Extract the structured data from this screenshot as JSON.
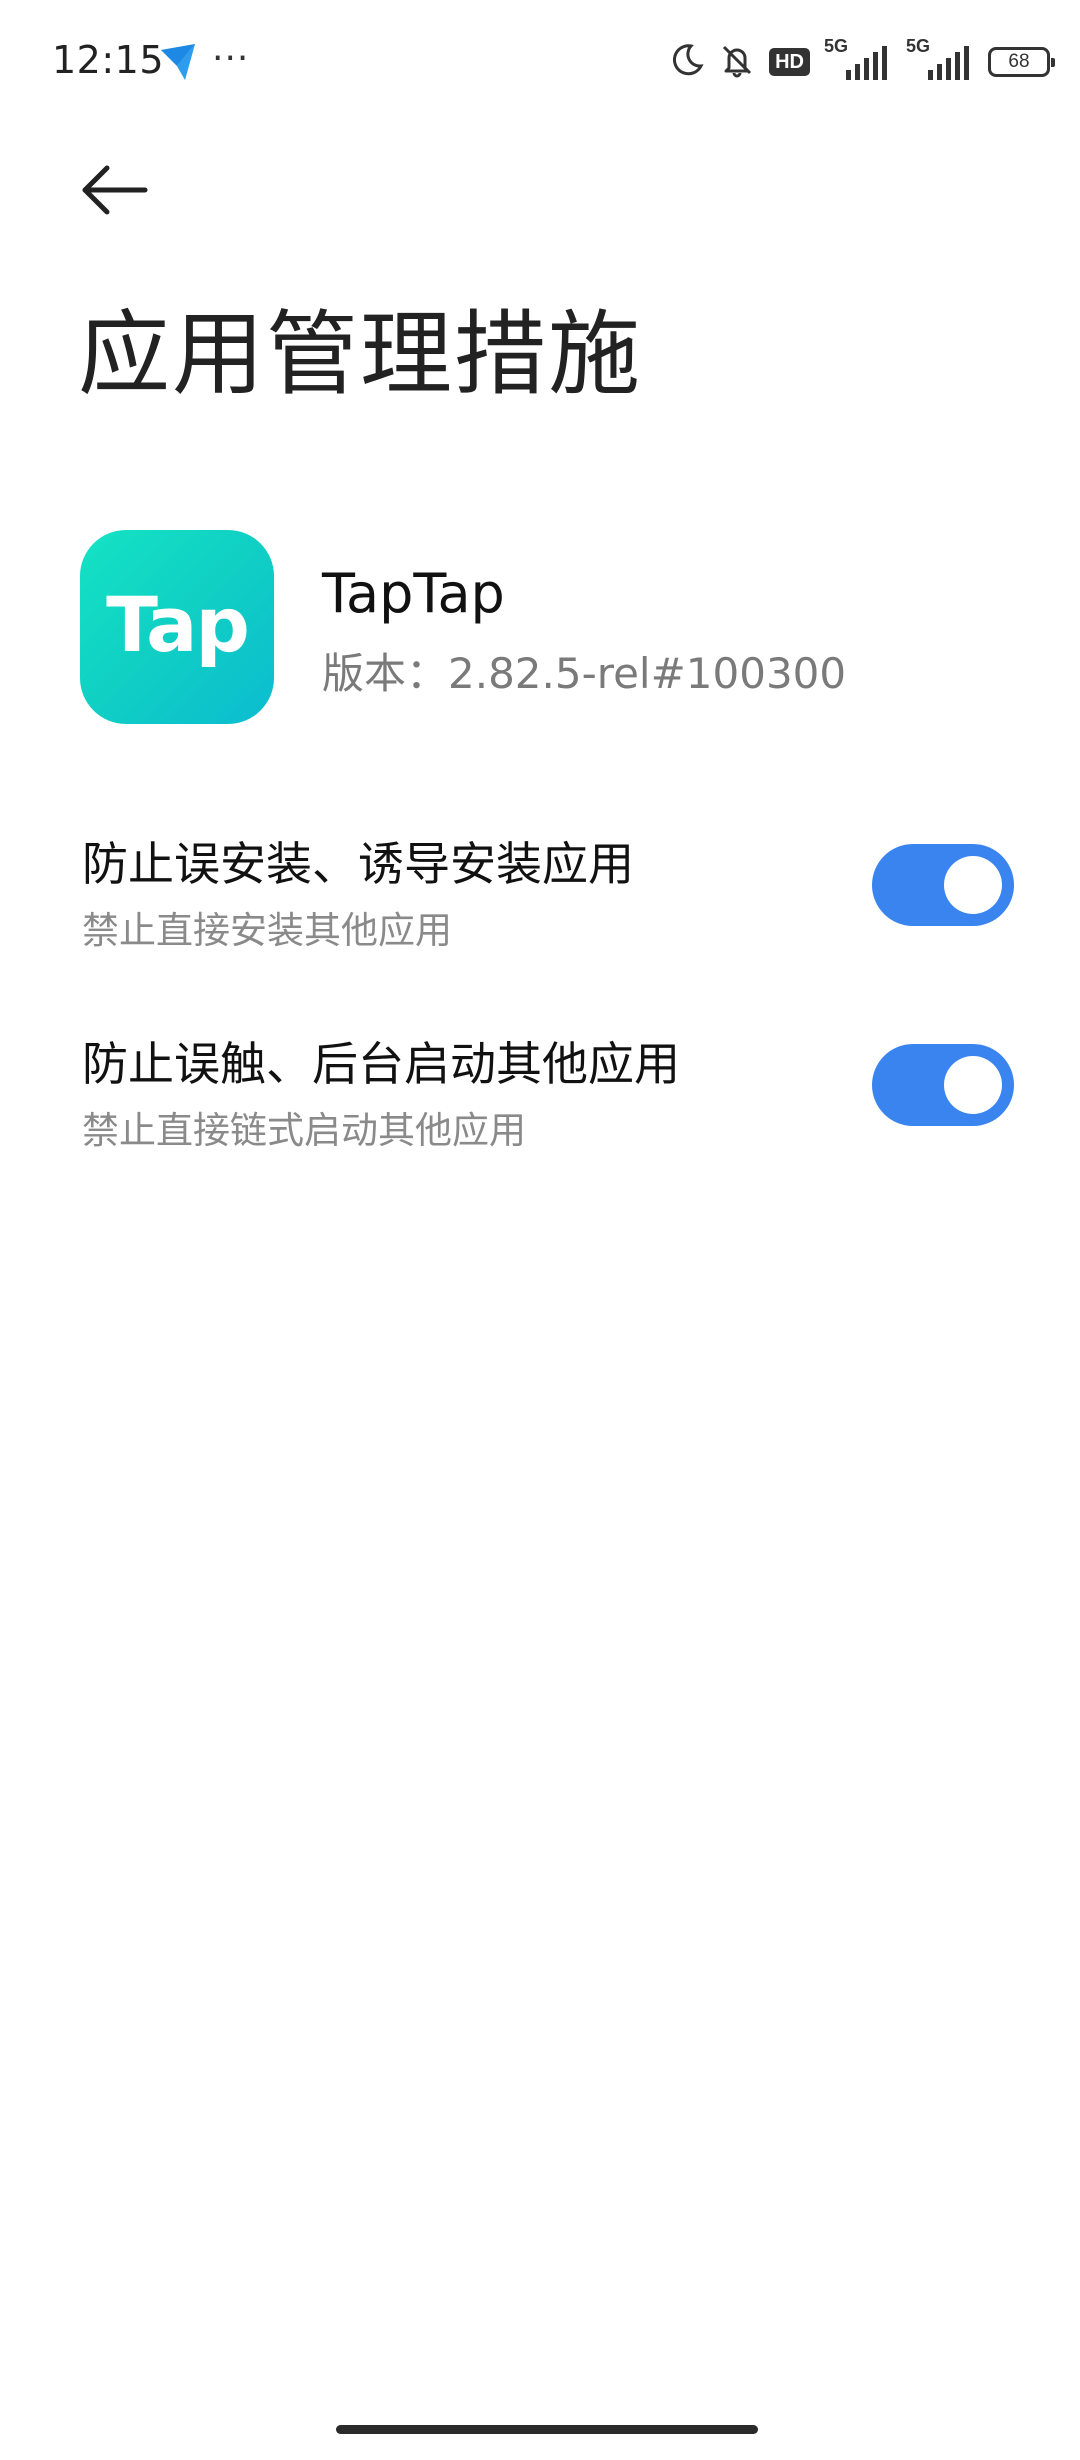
{
  "status_bar": {
    "time": "12:15",
    "dots": "···",
    "hd_badge": "HD",
    "network_1": "5G",
    "network_2": "5G",
    "battery": "68"
  },
  "header": {
    "title": "应用管理措施"
  },
  "app": {
    "icon_text": "Tap",
    "name": "TapTap",
    "version": "版本：2.82.5-rel#100300",
    "icon_colors": [
      "#14e3c4",
      "#0bbcd0"
    ]
  },
  "settings": [
    {
      "title": "防止误安装、诱导安装应用",
      "subtitle": "禁止直接安装其他应用",
      "enabled": true
    },
    {
      "title": "防止误触、后台启动其他应用",
      "subtitle": "禁止直接链式启动其他应用",
      "enabled": true
    }
  ],
  "colors": {
    "toggle_on": "#3a84f0",
    "text_primary": "#111111",
    "text_secondary": "#8a8a8a"
  },
  "icons": [
    "back-arrow-icon",
    "moon-icon",
    "bell-muted-icon",
    "signal-icon",
    "battery-icon",
    "send-app-icon"
  ]
}
